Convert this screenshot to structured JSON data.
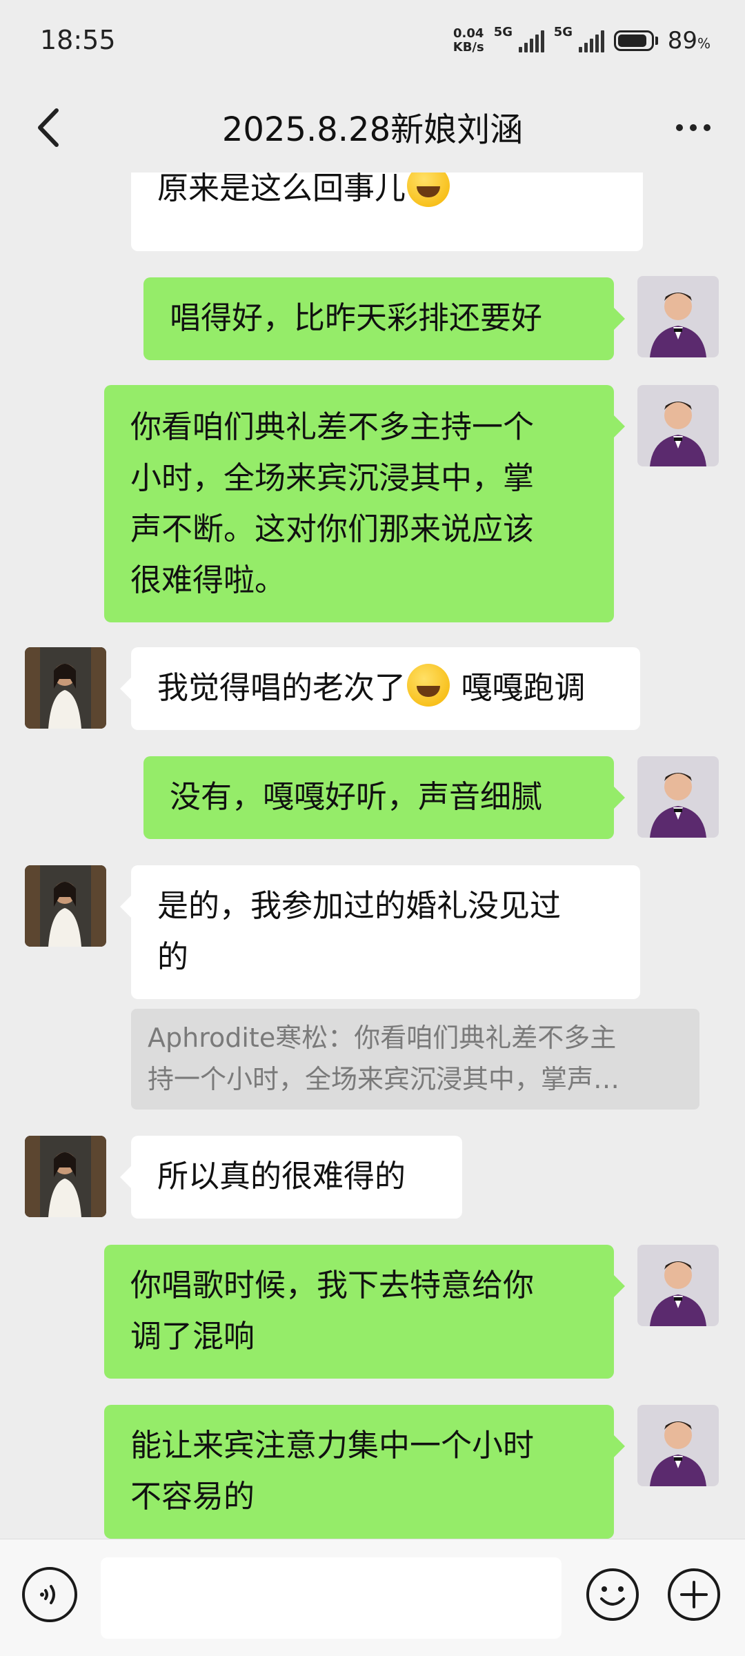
{
  "status_bar": {
    "time": "18:55",
    "net_speed_value": "0.04",
    "net_speed_unit": "KB/s",
    "sim1_label": "5G",
    "sim2_label": "5G",
    "battery_percent": "89",
    "battery_unit": "%"
  },
  "header": {
    "title": "2025.8.28新娘刘涵",
    "back_icon": "chevron-left-icon",
    "more_icon": "more-dots-icon"
  },
  "messages": [
    {
      "side": "left",
      "line1": "原来是这么回事儿",
      "emoji": "laughing-tears-emoji"
    },
    {
      "side": "right",
      "text": "唱得好，比昨天彩排还要好"
    },
    {
      "side": "right",
      "lines": [
        "你看咱们典礼差不多主持一个",
        "小时，全场来宾沉浸其中，掌",
        "声不断。这对你们那来说应该",
        "很难得啦。"
      ]
    },
    {
      "side": "left",
      "text_before": "我觉得唱的老次了",
      "emoji": "crying-laughing-emoji",
      "text_after": " 嘎嘎跑调"
    },
    {
      "side": "right",
      "text": "没有，嘎嘎好听，声音细腻"
    },
    {
      "side": "left",
      "lines": [
        "是的，我参加过的婚礼没见过",
        "的"
      ]
    },
    {
      "side": "left",
      "text": "所以真的很难得的"
    },
    {
      "side": "right",
      "lines": [
        "你唱歌时候，我下去特意给你",
        "调了混响"
      ]
    },
    {
      "side": "right",
      "lines": [
        "能让来宾注意力集中一个小时",
        "不容易的"
      ]
    }
  ],
  "quote": {
    "line1": "Aphrodite寒松：你看咱们典礼差不多主",
    "line2": "持一个小时，全场来宾沉浸其中，掌声…"
  },
  "input_bar": {
    "placeholder": "",
    "voice_icon": "voice-icon",
    "emoji_icon": "emoji-icon",
    "plus_icon": "plus-icon"
  },
  "colors": {
    "background": "#ededed",
    "bubble_self": "#95ec69",
    "bubble_other": "#ffffff",
    "quote_bg": "#dcdcdc"
  }
}
